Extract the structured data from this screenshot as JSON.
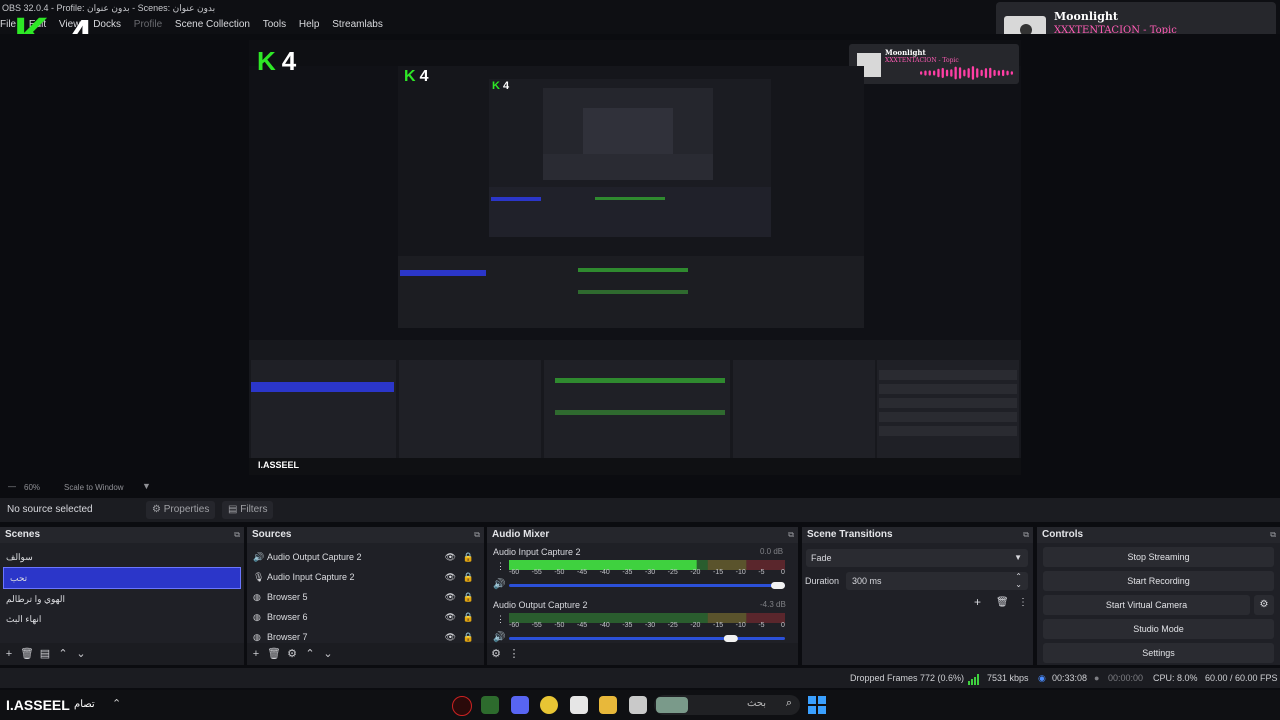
{
  "window": {
    "title": "OBS 32.0.4 - Profile: بدون عنوان - Scenes: بدون عنوان"
  },
  "menu": {
    "items": [
      "File",
      "Edit",
      "View",
      "Docks",
      "Profile",
      "Scene Collection",
      "Tools",
      "Help",
      "Streamlabs"
    ]
  },
  "logo": {
    "letter": "K",
    "digit": "4"
  },
  "now_playing": {
    "title": "Moonlight",
    "artist": "XXXTENTACION - Topic"
  },
  "zoom": {
    "level": "60%",
    "mode": "Scale to Window"
  },
  "selection": {
    "label": "No source selected",
    "properties": "Properties",
    "filters": "Filters"
  },
  "scenes": {
    "header": "Scenes",
    "items": [
      "سوالف",
      "تحب",
      "الهوي وا ترطالم",
      "انهاء البث"
    ],
    "selected_index": 1
  },
  "sources": {
    "header": "Sources",
    "items": [
      {
        "name": "Audio Output Capture 2",
        "icon": "speaker-icon"
      },
      {
        "name": "Audio Input Capture 2",
        "icon": "mic-icon"
      },
      {
        "name": "Browser 5",
        "icon": "globe-icon"
      },
      {
        "name": "Browser 6",
        "icon": "globe-icon"
      },
      {
        "name": "Browser 7",
        "icon": "globe-icon"
      }
    ]
  },
  "mixer": {
    "header": "Audio Mixer",
    "channels": [
      {
        "name": "Audio Input Capture 2",
        "db": "0.0 dB",
        "level": 0.68,
        "volume": 1.0
      },
      {
        "name": "Audio Output Capture 2",
        "db": "-4.3 dB",
        "level": 0.0,
        "volume": 0.82
      }
    ],
    "scale": [
      "-60",
      "-55",
      "-50",
      "-45",
      "-40",
      "-35",
      "-30",
      "-25",
      "-20",
      "-15",
      "-10",
      "-5",
      "0"
    ]
  },
  "transitions": {
    "header": "Scene Transitions",
    "type": "Fade",
    "duration_label": "Duration",
    "duration": "300 ms"
  },
  "controls": {
    "header": "Controls",
    "buttons": [
      "Stop Streaming",
      "Start Recording",
      "Start Virtual Camera",
      "Studio Mode",
      "Settings"
    ]
  },
  "status": {
    "dropped": "Dropped Frames 772 (0.6%)",
    "bitrate": "7531 kbps",
    "stream_time": "00:33:08",
    "rec_time": "00:00:00",
    "cpu": "CPU: 8.0%",
    "fps": "60.00 / 60.00 FPS"
  },
  "taskbar": {
    "brand": "I.ASSEEL",
    "brand_tag": "تصام",
    "search": "بحث"
  },
  "colors": {
    "accent": "#2b36c9",
    "meter_green": "#3fd13f",
    "meter_yellow": "#c9b43a",
    "meter_red": "#c9343a",
    "music_pink": "#ff3ea5",
    "logo_green": "#2ee826"
  }
}
